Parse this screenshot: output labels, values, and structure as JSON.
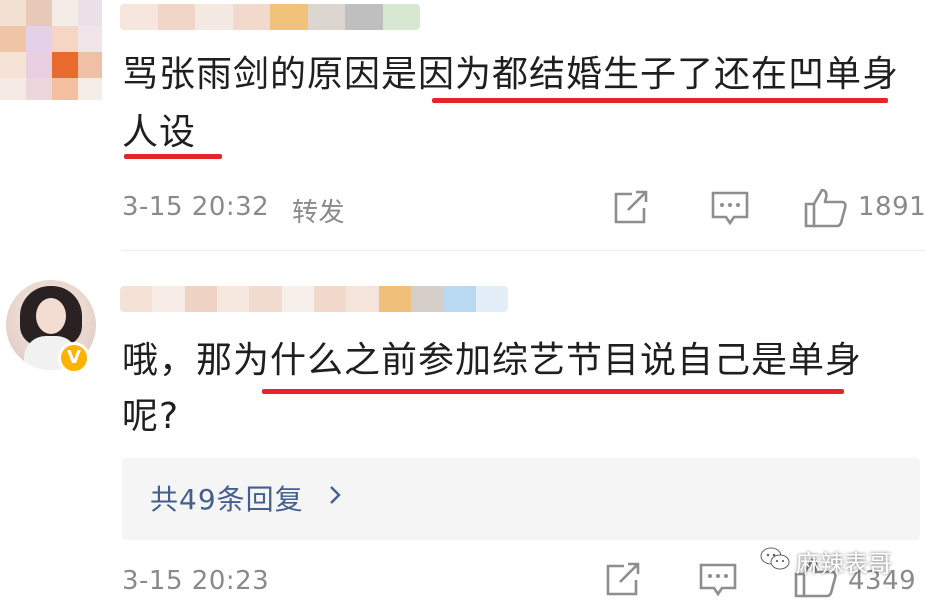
{
  "comment1": {
    "text_line1": "骂张雨剑的原因是因为都结婚生子了还在凹单身",
    "text_line2": "人设",
    "time": "3-15 20:32",
    "forward_label": "转发",
    "like_count": "1891",
    "icons": [
      "share-icon",
      "comment-icon",
      "like-icon"
    ]
  },
  "comment2": {
    "text_line1": "哦，那为什么之前参加综艺节目说自己是单身",
    "text_line2": "呢?",
    "verified_badge": "V",
    "replies_link": "共49条回复",
    "time": "3-15 20:23",
    "like_count": "4349",
    "icons": [
      "share-icon",
      "comment-icon",
      "like-icon"
    ]
  },
  "watermark": {
    "text": "麻辣表哥",
    "icon": "wechat-icon"
  },
  "colors": {
    "underline": "#e8232c",
    "link": "#445f8c",
    "meta": "#8a8a8a",
    "badge": "#ffb300"
  }
}
